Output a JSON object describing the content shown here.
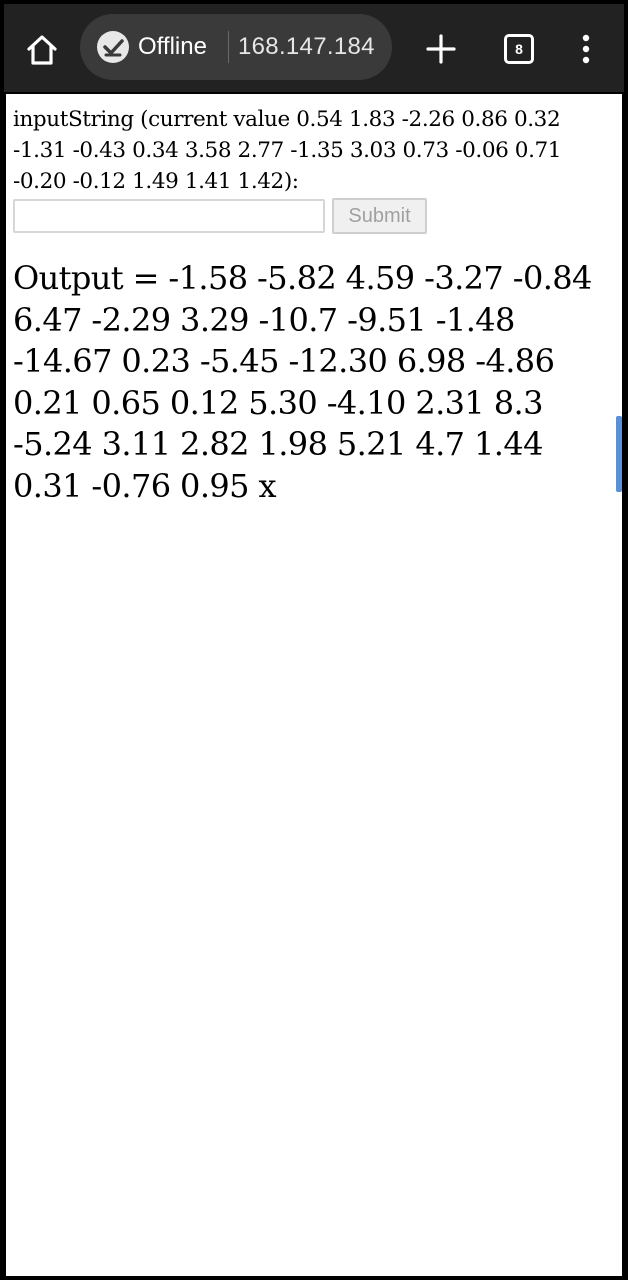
{
  "browser": {
    "status": "Offline",
    "url": "168.147.184",
    "tab_count": "8",
    "icons": {
      "home": "home-icon",
      "status": "offline-check-icon",
      "new_tab": "plus-icon",
      "tabs": "tabs-icon",
      "menu": "more-vert-icon"
    }
  },
  "page": {
    "prompt": "inputString (current value 0.54 1.83 -2.26 0.86 0.32 -1.31 -0.43 0.34 3.58 2.77 -1.35 3.03 0.73 -0.06 0.71 -0.20 -0.12 1.49 1.41 1.42):",
    "input_value": "",
    "submit_label": "Submit",
    "output": "Output = -1.58 -5.82 4.59 -3.27 -0.84 6.47 -2.29 3.29 -10.7 -9.51 -1.48 -14.67 0.23 -5.45 -12.30 6.98 -4.86 0.21 0.65 0.12 5.30 -4.10 2.31 8.3 -5.24 3.11 2.82 1.98 5.21 4.7 1.44 0.31 -0.76 0.95 x"
  },
  "colors": {
    "toolbar_bg": "#222222",
    "pill_bg": "#3a3a3a",
    "scroll_accent": "#5b8fd6"
  }
}
